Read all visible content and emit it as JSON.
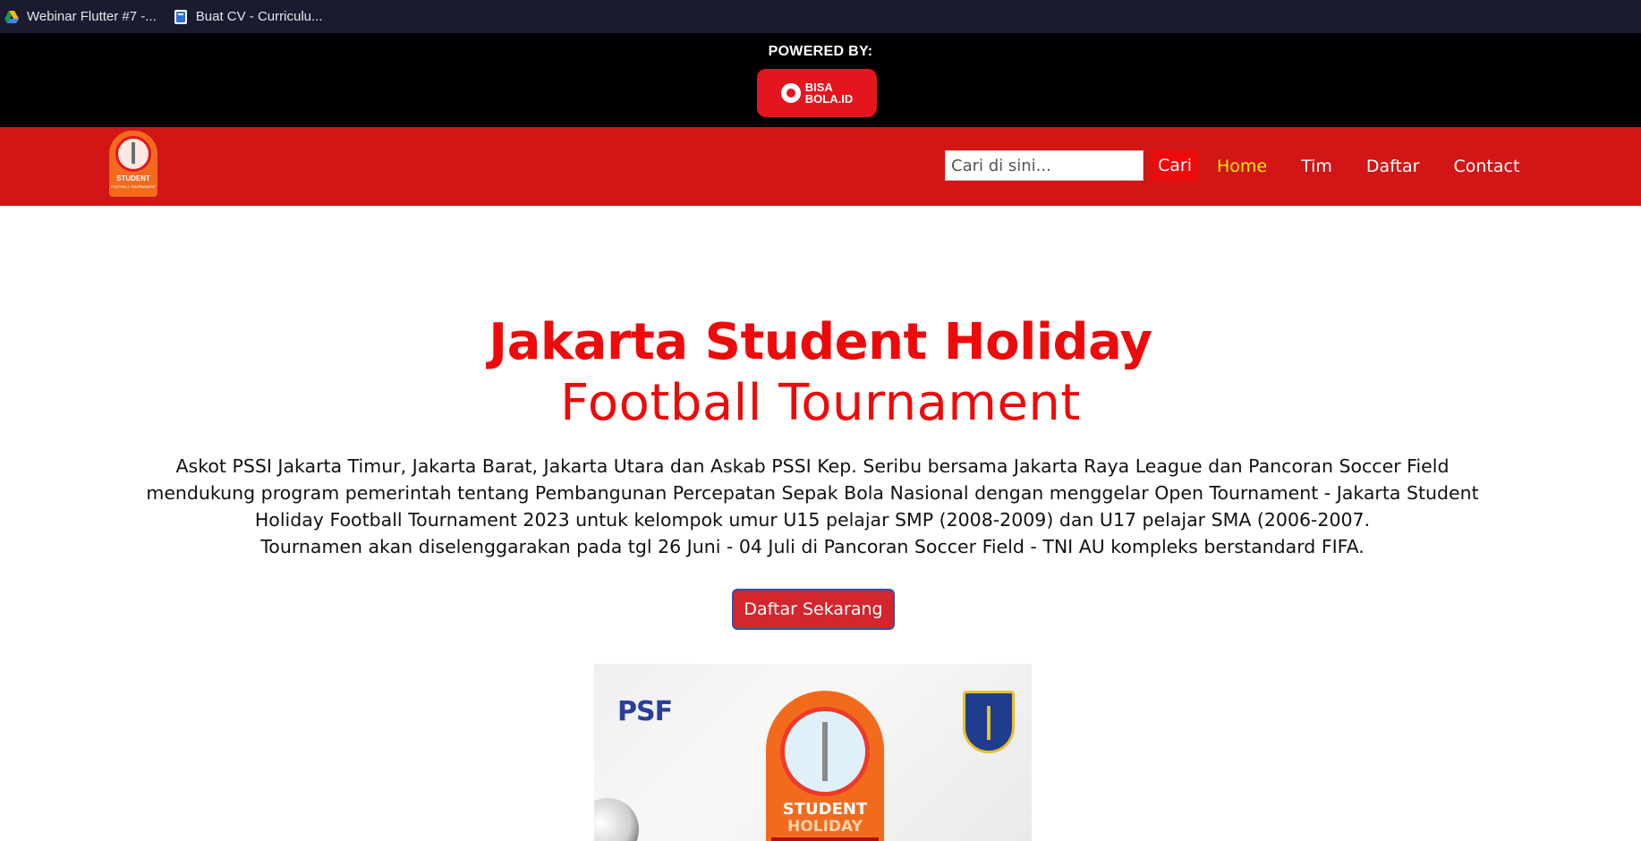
{
  "bookmarks": [
    {
      "label": "Webinar Flutter #7 -...",
      "icon": "google-drive-icon"
    },
    {
      "label": "Buat CV - Curriculu...",
      "icon": "cv-doc-icon"
    }
  ],
  "powered": {
    "label": "POWERED BY:",
    "sponsor_lines": [
      "BISA",
      "BOLA.ID"
    ]
  },
  "brand": {
    "line1": "STUDENT",
    "line2": "FOOTBALL TOURNAMENT"
  },
  "search": {
    "placeholder": "Cari di sini...",
    "button": "Cari"
  },
  "nav": {
    "items": [
      {
        "label": "Home",
        "active": true
      },
      {
        "label": "Tim",
        "active": false
      },
      {
        "label": "Daftar",
        "active": false
      },
      {
        "label": "Contact",
        "active": false
      }
    ]
  },
  "hero": {
    "title_1": "Jakarta Student Holiday",
    "title_2": "Football Tournament",
    "paragraph_1": "Askot PSSI Jakarta Timur, Jakarta Barat, Jakarta Utara dan Askab PSSI Kep. Seribu bersama Jakarta Raya League dan Pancoran Soccer Field mendukung program pemerintah tentang Pembangunan Percepatan Sepak Bola Nasional dengan menggelar Open Tournament - Jakarta Student Holiday Football Tournament 2023 untuk kelompok umur U15 pelajar SMP (2008-2009) dan U17 pelajar SMA (2006-2007.",
    "paragraph_2": "Tournamen akan diselenggarakan pada tgl 26 Juni - 04 Juli di Pancoran Soccer Field - TNI AU kompleks berstandard FIFA.",
    "cta": "Daftar Sekarang"
  },
  "poster": {
    "psf": "PSF",
    "student": "STUDENT",
    "holiday": "HOLIDAY"
  },
  "colors": {
    "navbar": "#d21515",
    "accent": "#ee0a0a",
    "active_nav": "#ffe600",
    "topbar": "#000000"
  }
}
